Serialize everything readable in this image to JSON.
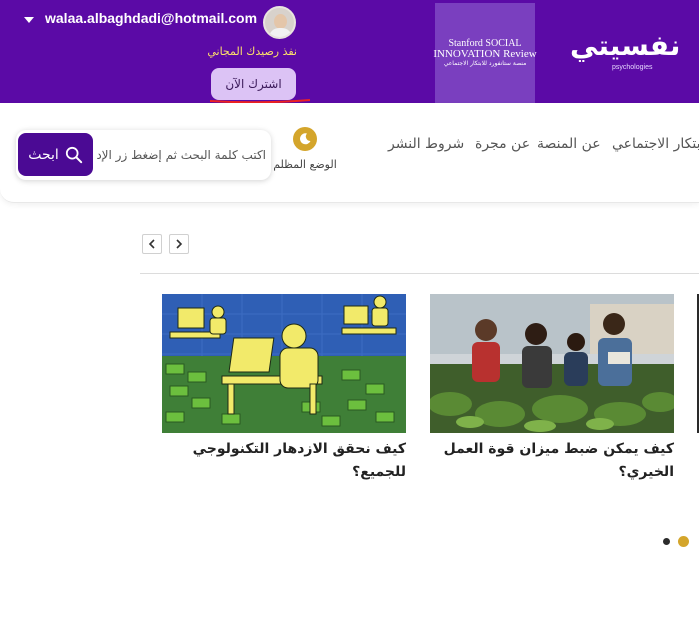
{
  "header": {
    "user_email": "walaa.albaghdadi@hotmail.com",
    "credit_text": "نفذ رصيدك المجاني",
    "subscribe_label": "اشترك الآن",
    "partner_logo": {
      "line1": "Stanford SOCIAL",
      "line2": "INNOVATION Review",
      "line3": "منصة ستانفورد للابتكار الاجتماعي"
    },
    "site_logo": {
      "arabic": "نفسيتي",
      "english": "psychologies"
    },
    "colors": {
      "brand_purple": "#5b0aa6",
      "accent_yellow": "#fde26a",
      "subscribe_bg": "#dcc3f5"
    }
  },
  "nav": {
    "items": [
      "الابتكار الاجتماعي",
      "عن المنصة",
      "عن مجرة",
      "شروط النشر"
    ],
    "dark_mode_label": "الوضع المظلم",
    "search_placeholder": "اكتب كلمة البحث ثم إضغط زر الإدخال",
    "search_button": "ابحث",
    "icons": {
      "search": "search-icon",
      "dark_mode": "moon-icon"
    }
  },
  "carousel": {
    "prev_icon": "chevron-left-icon",
    "next_icon": "chevron-right-icon",
    "cards": [
      {
        "title_line1": "كيف يمكن ضبط ميزان قوة العمل",
        "title_line2": "الخيري؟"
      },
      {
        "title_line1": "كيف نحقق الازدهار التكنولوجي",
        "title_line2": "للجميع؟"
      }
    ],
    "pagination": {
      "active_color": "#d4a52b",
      "inactive_color": "#2b2b2b",
      "active_index": 0,
      "count": 2
    }
  }
}
